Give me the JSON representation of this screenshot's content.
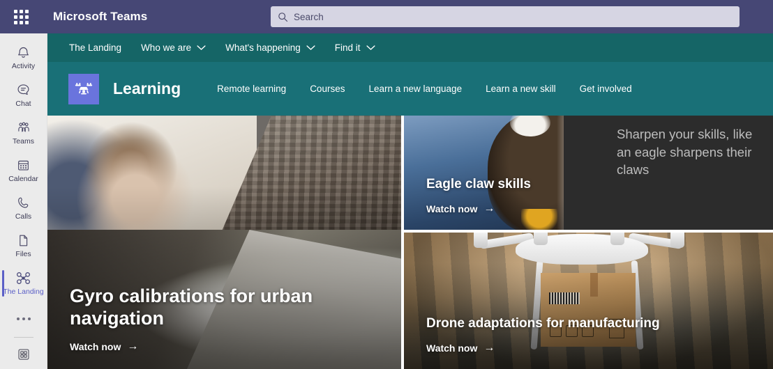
{
  "topbar": {
    "app_launcher_icon": "waffle-grid-icon",
    "app_title": "Microsoft Teams",
    "search": {
      "icon": "search-icon",
      "placeholder": "Search",
      "value": ""
    }
  },
  "rail": {
    "items": [
      {
        "label": "Activity",
        "icon": "bell-icon",
        "active": false
      },
      {
        "label": "Chat",
        "icon": "chat-icon",
        "active": false
      },
      {
        "label": "Teams",
        "icon": "teams-icon",
        "active": false
      },
      {
        "label": "Calendar",
        "icon": "calendar-icon",
        "active": false
      },
      {
        "label": "Calls",
        "icon": "phone-icon",
        "active": false
      },
      {
        "label": "Files",
        "icon": "file-icon",
        "active": false
      },
      {
        "label": "The Landing",
        "icon": "drone-icon",
        "active": true
      }
    ],
    "more_icon": "ellipsis-icon",
    "apps_icon": "apps-grid-icon"
  },
  "team_nav": {
    "items": [
      {
        "label": "The Landing",
        "has_chevron": false
      },
      {
        "label": "Who we are",
        "has_chevron": true
      },
      {
        "label": "What's happening",
        "has_chevron": true
      },
      {
        "label": "Find it",
        "has_chevron": true
      }
    ],
    "chevron_icon": "chevron-down-icon"
  },
  "learning_header": {
    "logo_icon": "drone-logo-icon",
    "title": "Learning",
    "links": [
      "Remote learning",
      "Courses",
      "Learn a new language",
      "Learn a new skill",
      "Get involved"
    ]
  },
  "cards": {
    "gyro": {
      "title": "Gyro calibrations for urban navigation",
      "cta": "Watch now",
      "cta_arrow": "arrow-right-icon"
    },
    "eagle": {
      "title": "Eagle claw skills",
      "quote": "Sharpen your skills, like an eagle sharpens their claws",
      "cta": "Watch now",
      "cta_arrow": "arrow-right-icon"
    },
    "drone": {
      "title": "Drone adaptations for manufacturing",
      "cta": "Watch now",
      "cta_arrow": "arrow-right-icon"
    }
  },
  "colors": {
    "topbar_purple": "#464775",
    "team_nav_teal": "#156566",
    "learning_teal": "#197077",
    "rail_bg": "#ebebeb",
    "accent_purple": "#5b5fc7",
    "logo_blue": "#6a74dd",
    "search_bg": "#d6d5e3"
  }
}
